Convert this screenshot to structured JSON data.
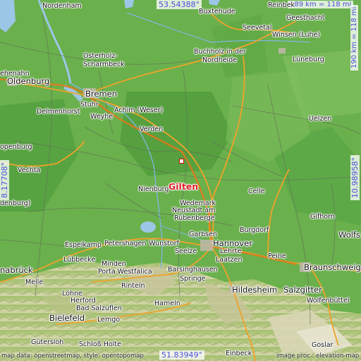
{
  "highlight": "Gilten",
  "coordinates": {
    "lat_top": "53.54388°",
    "lat_bottom": "51.83949°",
    "lon_left": "8.17708°",
    "lon_right": "10.98958°"
  },
  "scale": {
    "horizontal": "189 km = 118 mi",
    "vertical": "190 km = 118 mi"
  },
  "attribution": {
    "left": "map data: openstreetmap, style: opentopomap",
    "right": "image proc.: elevation-map"
  },
  "places": {
    "nordenham": "Nordenham",
    "buxtehude": "Buxtehude",
    "reinbek": "Reinbek",
    "geesthacht": "Geesthacht",
    "seevetal": "Seevetal",
    "winsen": "Winsen (Luhe)",
    "buchholz": "Buchholz in der",
    "nordheide": "Nordheide",
    "lueneburg": "Lüneburg",
    "osterholz": "Osterholz-",
    "scharmbeck": "Scharmbeck",
    "ehenahn": "ehenahn",
    "oldenburg": "Oldenburg",
    "bremen": "Bremen",
    "stuhr": "Stuhr",
    "delmenhorst": "Delmenhorst",
    "achim": "Achim (Weser)",
    "weyhe": "Weyhe",
    "verden": "Verden",
    "uelzen": "Uelzen",
    "openburg": "openburg",
    "vechta": "Vechta",
    "nienburg": "Nienburg",
    "celle": "Celle",
    "denburg": "denburg)",
    "wedemark": "Wedemark",
    "neustadt": "Neustadt am",
    "ruebenberge": "Rübenberge",
    "gifhorn": "Gifhorn",
    "wolfs": "Wolfs",
    "garbsen": "Garbsen",
    "burgdorf": "Burgdorf",
    "espelkamp": "Espelkamp",
    "petershagen": "Petershagen",
    "wunstorf": "Wunstorf",
    "hannover": "Hannover",
    "seelze": "Seelze",
    "lehrte": "Lehrte",
    "peine": "Peine",
    "braunschweig": "Braunschweig",
    "nabrueck": "nabrück",
    "luebbecke": "Lübbecke",
    "minden": "Minden",
    "porta": "Porta Westfalica",
    "laatzen": "Laatzen",
    "barsinghausen": "Barsinghausen",
    "springe": "Springe",
    "hildesheim": "Hildesheim",
    "salzgitter": "Salzgitter",
    "melle": "Melle",
    "loehne": "Löhne",
    "rinteln": "Rinteln",
    "wolfenbuettel": "Wolfenbüttel",
    "herford": "Herford",
    "bad_salzuflen": "Bad Salzuflen",
    "hameln": "Hameln",
    "bielefeld": "Bielefeld",
    "lemgo": "Lemgo",
    "guetersloh": "Gütersloh",
    "schloss_holte": "Schloß Holte",
    "goslar": "Goslar",
    "einbeck": "Einbeck"
  },
  "colors": {
    "lowland": "#6ab04c",
    "hills": "#b9c98a",
    "water": "#9cc6e6",
    "roads": "#f0a22a",
    "coord_text": "#4a50d8",
    "highlight": "#e0202a"
  }
}
